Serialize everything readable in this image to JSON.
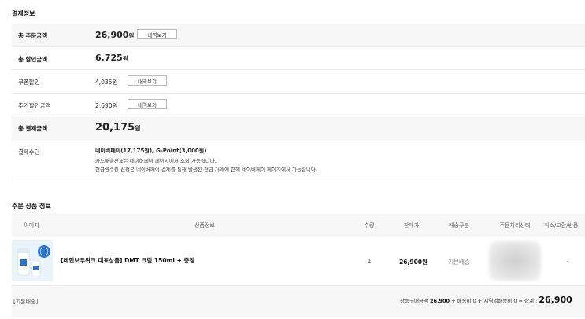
{
  "payment": {
    "title": "결제정보",
    "total_order_label": "총 주문금액",
    "total_order_amount": "26,900",
    "total_order_unit": "원",
    "detail_button": "내역보기",
    "total_discount_label": "총 할인금액",
    "total_discount_amount": "6,725",
    "total_discount_unit": "원",
    "coupon_label": "쿠폰할인",
    "coupon_amount": "4,035원",
    "extra_discount_label": "추가할인금액",
    "extra_discount_amount": "2,690원",
    "total_payment_label": "총 결제금액",
    "total_payment_amount": "20,175",
    "total_payment_unit": "원",
    "method_label": "결제수단",
    "method_main": "네이버페이(17,175원), G-Point(3,000원)",
    "method_note1": "카드매출전표는 네이버페이 페이지에서 조회 가능합니다.",
    "method_note2": "현금영수증 신청은 네이버페이 결제를 통해 발생된 현금 거래에 한해 네이버페이 페이지에서 가능합니다."
  },
  "order": {
    "title": "주문 상품 정보",
    "headers": {
      "image": "이미지",
      "info": "상품정보",
      "qty": "수량",
      "price": "판매가",
      "shipping": "배송구분",
      "status": "주문처리상태",
      "cancel": "취소/교환/반품"
    },
    "item": {
      "name": "[레인보우위크 대표상품] DMT 크림 150ml + 증정",
      "qty": "1",
      "price": "26,900원",
      "shipping": "기본배송",
      "cancel": "-"
    },
    "footer": {
      "shipping_type": "[기본배송]",
      "summary_prefix": "상품구매금액",
      "summary_amount": "26,900",
      "summary_rest": "+ 배송비 0 + 지역별배송비 0 = 합계 :",
      "total": "26,900"
    }
  },
  "colors": {
    "row_shade": "#f7f7f7",
    "border": "#ececec",
    "blur": "#d8d8d8"
  }
}
